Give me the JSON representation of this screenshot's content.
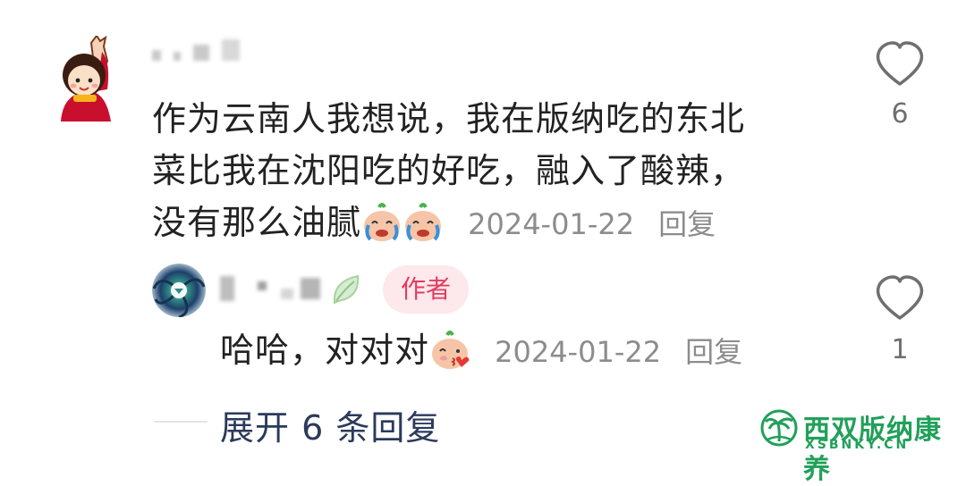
{
  "comment": {
    "text_lines": [
      "作为云南人我想说，我在版纳吃的东北",
      "菜比我在沈阳吃的好吃，融入了酸辣，",
      "没有那么油腻"
    ],
    "date": "2024-01-22",
    "reply_label": "回复",
    "likes": "6",
    "emoji_icons": [
      "crying-peach-emoji",
      "crying-peach-emoji"
    ]
  },
  "reply": {
    "badge": "作者",
    "text": "哈哈，对对对",
    "date": "2024-01-22",
    "reply_label": "回复",
    "likes": "1",
    "emoji_icon": "kiss-peach-emoji"
  },
  "expand": {
    "label": "展开 6 条回复"
  },
  "watermark": {
    "title": "西双版纳康养",
    "subtitle": "XSBNKY.CN"
  },
  "colors": {
    "author_badge_bg": "#fde8ec",
    "author_badge_text": "#e33b5f",
    "expand_text": "#2b3a5c",
    "watermark": "#21a05a",
    "meta": "#8c8c8c"
  }
}
